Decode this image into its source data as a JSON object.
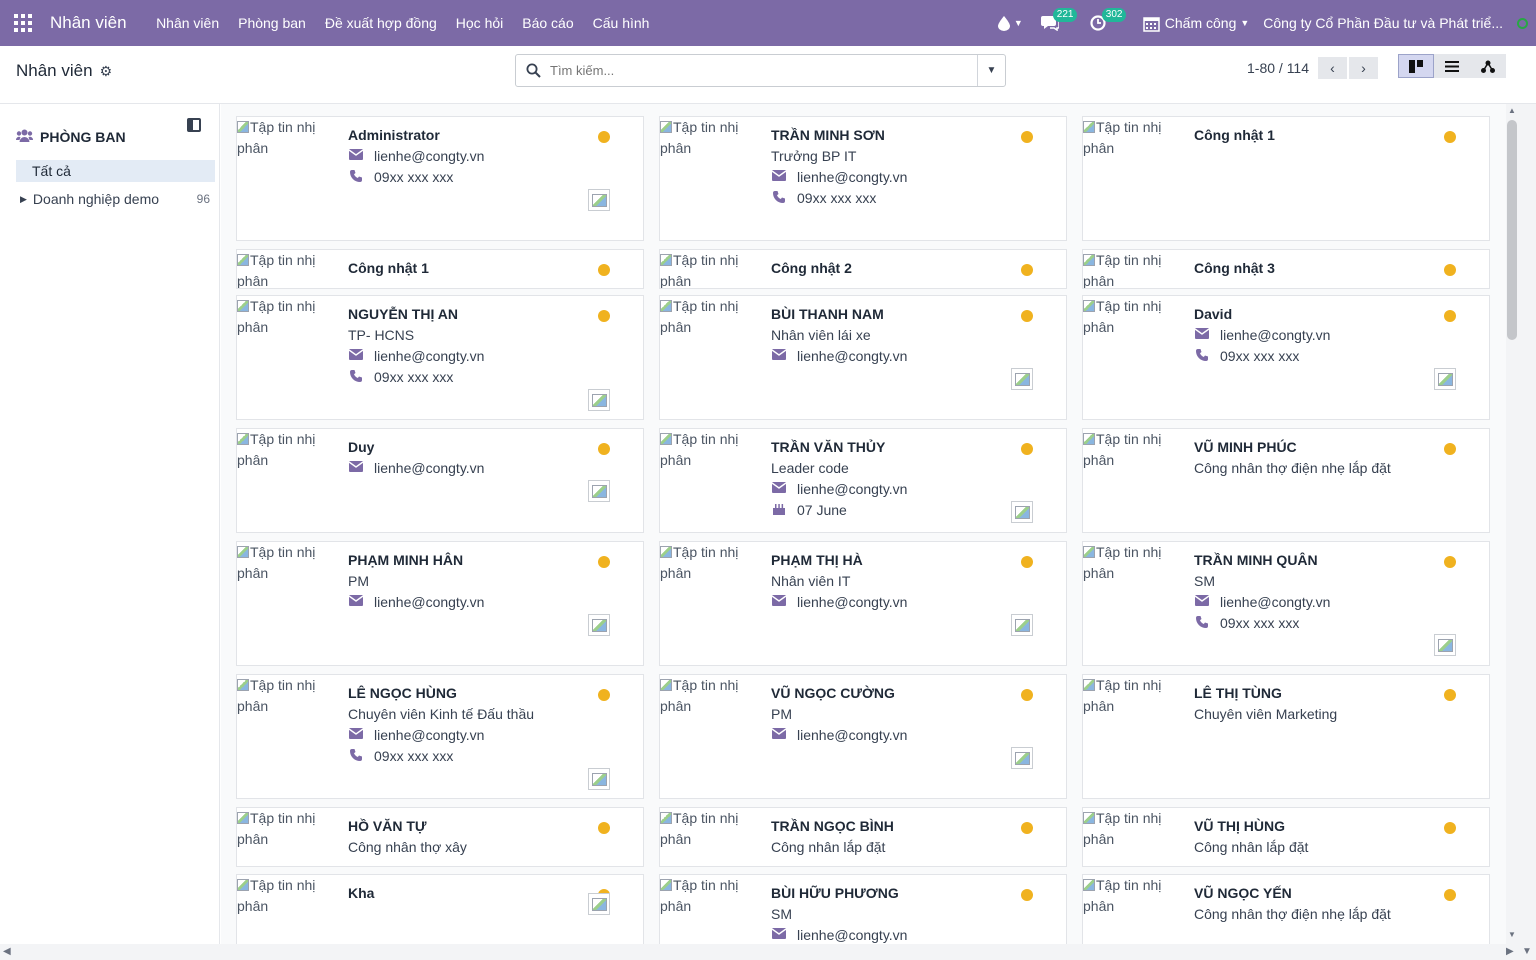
{
  "navbar": {
    "brand": "Nhân viên",
    "menu": [
      "Nhân viên",
      "Phòng ban",
      "Đề xuất hợp đồng",
      "Học hỏi",
      "Báo cáo",
      "Cấu hình"
    ],
    "messages_count": "221",
    "activities_count": "302",
    "attendance_label": "Chấm công",
    "company": "Công ty Cổ Phần Đầu tư và Phát triể..."
  },
  "control": {
    "title": "Nhân viên",
    "search_placeholder": "Tìm kiếm...",
    "pager": "1-80 / 114"
  },
  "sidebar": {
    "header": "PHÒNG BAN",
    "all": "Tất cả",
    "items": [
      {
        "label": "Doanh nghiệp demo",
        "count": "96"
      }
    ]
  },
  "image_alt": "Tập tin nhị phân",
  "cards": [
    {
      "name": "Administrator",
      "job": "",
      "email": "lienhe@congty.vn",
      "phone": "09xx xxx xxx",
      "birthday": ""
    },
    {
      "name": "TRẦN MINH SƠN",
      "job": "Trưởng BP IT",
      "email": "lienhe@congty.vn",
      "phone": "09xx xxx xxx",
      "birthday": ""
    },
    {
      "name": "Công nhật 1",
      "job": "",
      "email": "",
      "phone": "",
      "birthday": ""
    },
    {
      "name": "Công nhật 1",
      "job": "",
      "email": "",
      "phone": "",
      "birthday": ""
    },
    {
      "name": "Công nhật 2",
      "job": "",
      "email": "",
      "phone": "",
      "birthday": ""
    },
    {
      "name": "Công nhật 3",
      "job": "",
      "email": "",
      "phone": "",
      "birthday": ""
    },
    {
      "name": "NGUYỄN THỊ AN",
      "job": "TP- HCNS",
      "email": "lienhe@congty.vn",
      "phone": "09xx xxx xxx",
      "birthday": ""
    },
    {
      "name": "BÙI THANH NAM",
      "job": "Nhân viên lái xe",
      "email": "lienhe@congty.vn",
      "phone": "",
      "birthday": ""
    },
    {
      "name": "David",
      "job": "",
      "email": "lienhe@congty.vn",
      "phone": "09xx xxx xxx",
      "birthday": ""
    },
    {
      "name": "Duy",
      "job": "",
      "email": "lienhe@congty.vn",
      "phone": "",
      "birthday": ""
    },
    {
      "name": "TRẦN VĂN THỦY",
      "job": "Leader code",
      "email": "lienhe@congty.vn",
      "phone": "",
      "birthday": "07 June"
    },
    {
      "name": "VŨ MINH PHÚC",
      "job": "Công nhân thợ điện nhẹ lắp đặt",
      "email": "",
      "phone": "",
      "birthday": ""
    },
    {
      "name": "PHẠM MINH HÂN",
      "job": "PM",
      "email": "lienhe@congty.vn",
      "phone": "",
      "birthday": ""
    },
    {
      "name": "PHẠM THỊ HÀ",
      "job": "Nhân viên IT",
      "email": "lienhe@congty.vn",
      "phone": "",
      "birthday": ""
    },
    {
      "name": "TRẦN MINH QUÂN",
      "job": "SM",
      "email": "lienhe@congty.vn",
      "phone": "09xx xxx xxx",
      "birthday": ""
    },
    {
      "name": "LÊ NGỌC HÙNG",
      "job": "Chuyên viên Kinh tế Đấu thầu",
      "email": "lienhe@congty.vn",
      "phone": "09xx xxx xxx",
      "birthday": ""
    },
    {
      "name": "VŨ NGỌC CƯỜNG",
      "job": "PM",
      "email": "lienhe@congty.vn",
      "phone": "",
      "birthday": ""
    },
    {
      "name": "LÊ THỊ TÙNG",
      "job": "Chuyên viên Marketing",
      "email": "",
      "phone": "",
      "birthday": ""
    },
    {
      "name": "HỒ VĂN TỰ",
      "job": "Công nhân thợ xây",
      "email": "",
      "phone": "",
      "birthday": ""
    },
    {
      "name": "TRẦN NGỌC BÌNH",
      "job": "Công nhân lắp đặt",
      "email": "",
      "phone": "",
      "birthday": ""
    },
    {
      "name": "VŨ THỊ HÙNG",
      "job": "Công nhân lắp đặt",
      "email": "",
      "phone": "",
      "birthday": ""
    },
    {
      "name": "Kha",
      "job": "",
      "email": "",
      "phone": "",
      "birthday": ""
    },
    {
      "name": "BÙI HỮU PHƯƠNG",
      "job": "SM",
      "email": "lienhe@congty.vn",
      "phone": "",
      "birthday": ""
    },
    {
      "name": "VŨ NGỌC YẾN",
      "job": "Công nhân thợ điện nhẹ lắp đặt",
      "email": "",
      "phone": "",
      "birthday": ""
    }
  ],
  "colors": {
    "navbar": "#7c6aa6",
    "status": "#f0b21f",
    "accent": "#7c6aa6"
  }
}
